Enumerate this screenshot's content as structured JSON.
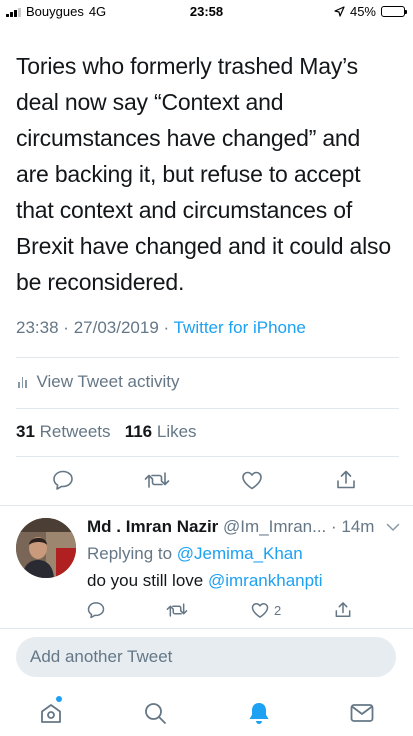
{
  "status_bar": {
    "carrier": "Bouygues",
    "network": "4G",
    "time": "23:58",
    "battery_percent": "45%",
    "battery_level": 0.45
  },
  "tweet": {
    "text": "Tories who formerly trashed May’s deal now say “Context and circumstances have changed” and are backing it, but refuse to accept that context and circumstances of Brexit have changed and it could also be reconsidered.",
    "time": "23:38",
    "separator": "·",
    "date": "27/03/2019",
    "source": "Twitter for iPhone",
    "activity_label": "View Tweet activity",
    "retweets_count": "31",
    "retweets_label": "Retweets",
    "likes_count": "116",
    "likes_label": "Likes"
  },
  "reply": {
    "name": "Md . Imran Nazir",
    "handle": "@Im_Imran...",
    "time": "· 14m",
    "replying_prefix": "Replying to",
    "replying_to": "@Jemima_Khan",
    "text_prefix": "do you still love",
    "text_mention": "@imrankhanpti",
    "like_count": "2"
  },
  "compose": {
    "placeholder": "Add another Tweet"
  },
  "colors": {
    "accent": "#1da1f2",
    "text": "#14171a",
    "secondary": "#657786",
    "divider": "#e1e8ed",
    "compose_bg": "#e6ecf0"
  },
  "icons": {
    "tweet_actions": [
      "reply-icon",
      "retweet-icon",
      "like-icon",
      "share-icon"
    ],
    "tabs": [
      "home-icon",
      "search-icon",
      "notifications-icon",
      "messages-icon"
    ]
  }
}
